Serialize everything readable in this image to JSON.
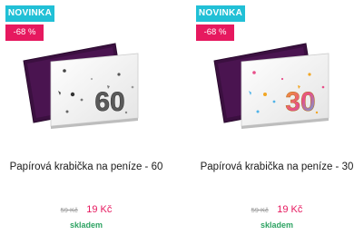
{
  "products": [
    {
      "badge_new": "NOVINKA",
      "badge_discount": "-68 %",
      "name": "Papírová krabička na peníze - 60",
      "image_number": "60",
      "price_old": "59 Kč",
      "price_new": "19 Kč",
      "availability": "skladem"
    },
    {
      "badge_new": "NOVINKA",
      "badge_discount": "-68 %",
      "name": "Papírová krabička na peníze - 30",
      "image_number": "30",
      "price_old": "59 Kč",
      "price_new": "19 Kč",
      "availability": "skladem"
    }
  ],
  "colors": {
    "badge_new": "#21c0d6",
    "badge_discount": "#e6195f",
    "price_new": "#e6195f",
    "availability": "#2ea363",
    "box_interior": "#3b1040"
  }
}
